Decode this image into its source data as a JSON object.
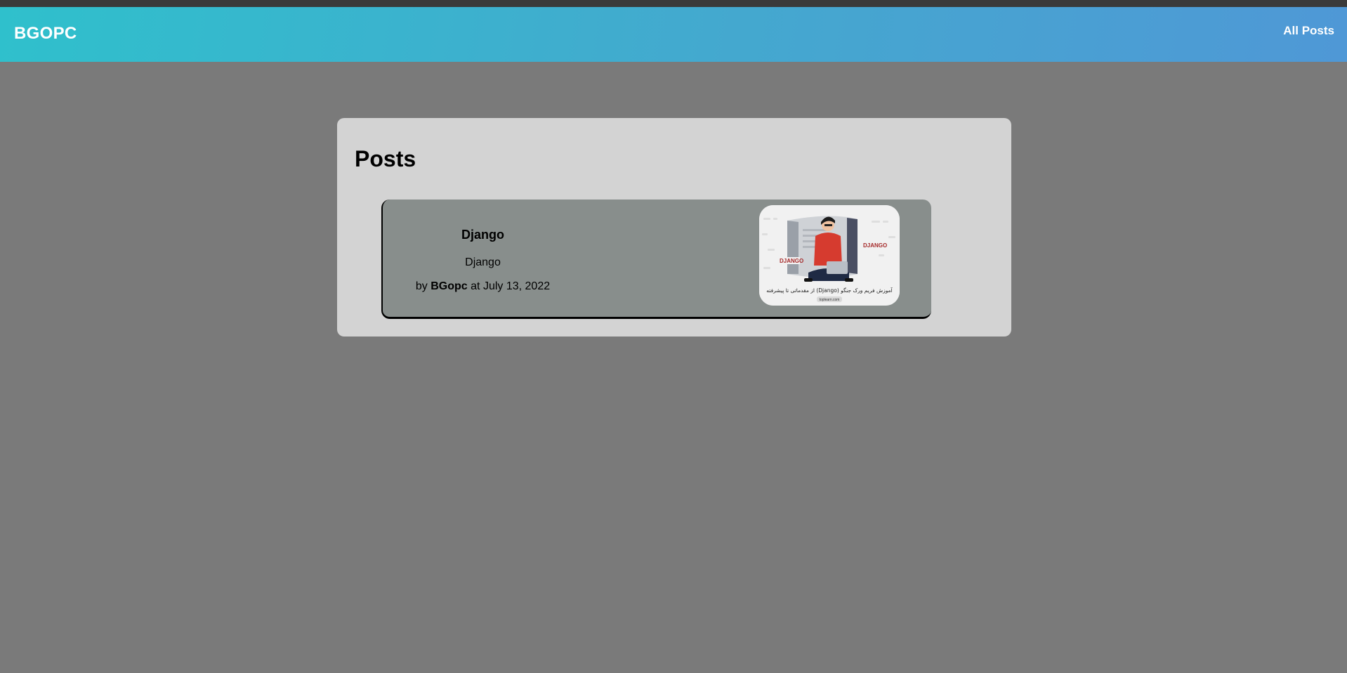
{
  "navbar": {
    "brand": "BGOPC",
    "link_all_posts": "All Posts"
  },
  "main": {
    "heading": "Posts",
    "posts": [
      {
        "title": "Django",
        "excerpt": "Django",
        "meta_prefix": "by",
        "author": "BGopc",
        "meta_middle": "at",
        "date": "July 13, 2022",
        "image": {
          "badge_left": "DJANGO",
          "badge_right": "DJANGO",
          "caption": "آموزش فریم ورک جنگو (Django) از مقدماتی تا پیشرفته",
          "site": "toplearn.com"
        }
      }
    ]
  },
  "colors": {
    "page_bg": "#7a7a7a",
    "navbar_start": "#2fc0cc",
    "navbar_end": "#4f98d6",
    "panel_bg": "#d3d3d3",
    "card_bg": "#888e8c",
    "badge_red": "#c0392b"
  }
}
